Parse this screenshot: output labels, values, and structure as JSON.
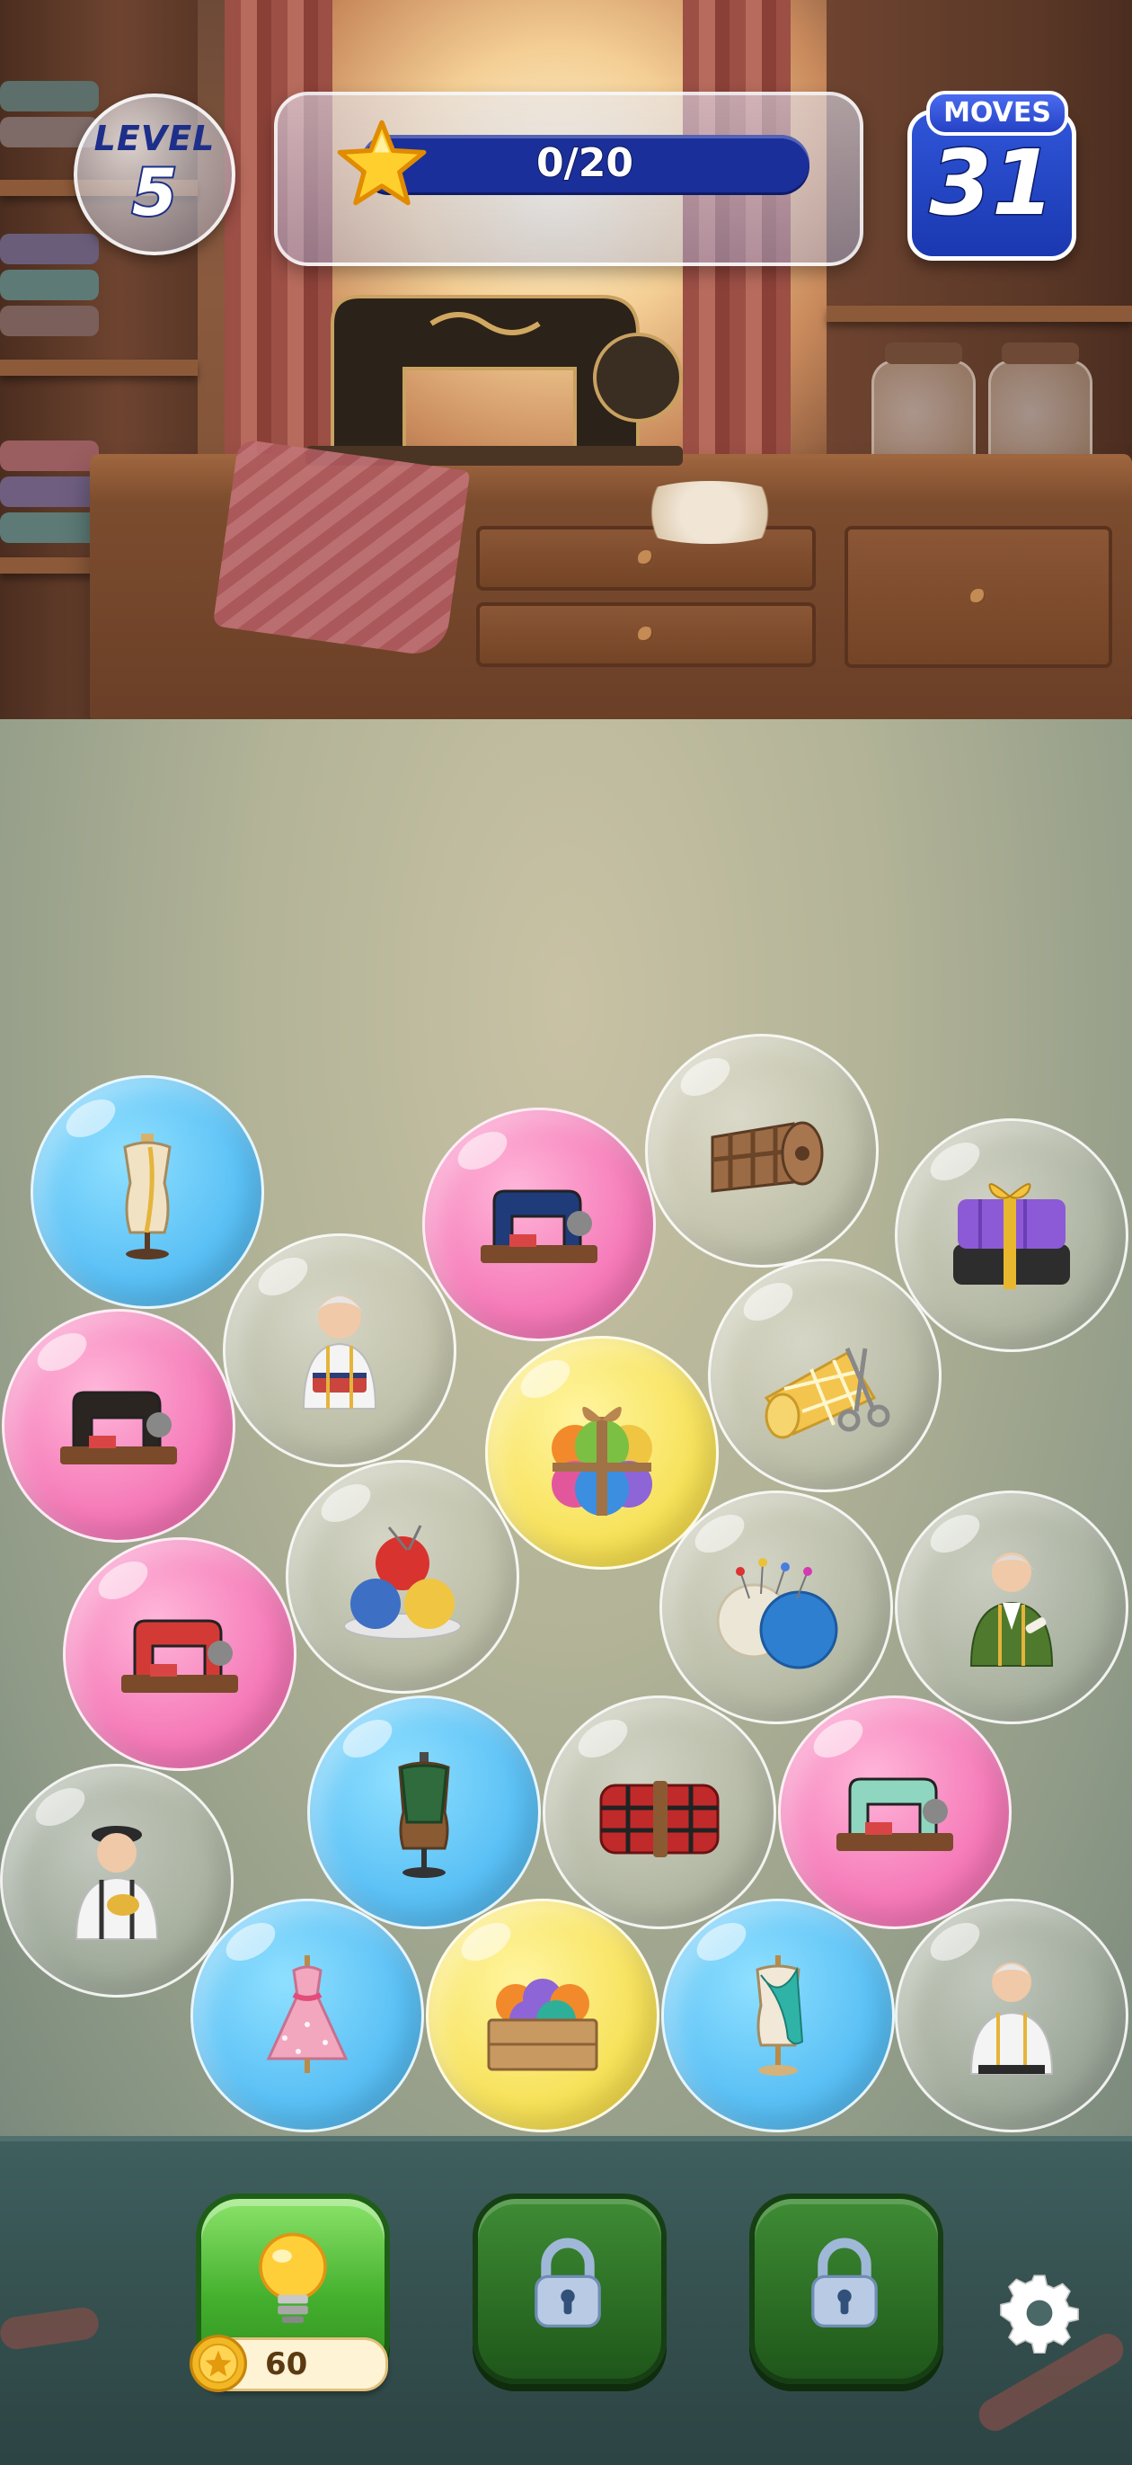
{
  "hud": {
    "level_label": "LEVEL",
    "level_number": "5",
    "progress_text": "0/20",
    "progress_fraction": 0,
    "moves_label": "MOVES",
    "moves_value": "31"
  },
  "bubbles": [
    {
      "color": "blue",
      "item": "dress-form-icon"
    },
    {
      "color": "pink",
      "item": "sewing-machine-icon"
    },
    {
      "color": "glass",
      "item": "fabric-roll-icon"
    },
    {
      "color": "glass",
      "item": "gift-fabric-icon"
    },
    {
      "color": "glass",
      "item": "grandma-tailor-icon"
    },
    {
      "color": "pink",
      "item": "sewing-machine-icon"
    },
    {
      "color": "yellow",
      "item": "yarn-gift-icon"
    },
    {
      "color": "glass",
      "item": "fabric-scissors-icon"
    },
    {
      "color": "glass",
      "item": "yarn-basket-icon"
    },
    {
      "color": "pink",
      "item": "sewing-machine-icon"
    },
    {
      "color": "glass",
      "item": "pin-yarn-icon"
    },
    {
      "color": "glass",
      "item": "tailor-woman-icon"
    },
    {
      "color": "blue",
      "item": "vest-mannequin-icon"
    },
    {
      "color": "glass",
      "item": "tartan-roll-icon"
    },
    {
      "color": "pink",
      "item": "sewing-machine-icon"
    },
    {
      "color": "glass",
      "item": "boy-tailor-icon"
    },
    {
      "color": "blue",
      "item": "pink-dress-icon"
    },
    {
      "color": "yellow",
      "item": "yarn-crate-icon"
    },
    {
      "color": "blue",
      "item": "scarf-mannequin-icon"
    },
    {
      "color": "glass",
      "item": "old-tailor-icon"
    }
  ],
  "boosters": {
    "hint_cost": "60",
    "lock_slots": 2
  },
  "colors": {
    "moves_bg": "#1f3fc0",
    "progress_track": "#1b2f9a",
    "hint_green": "#44b02e"
  }
}
